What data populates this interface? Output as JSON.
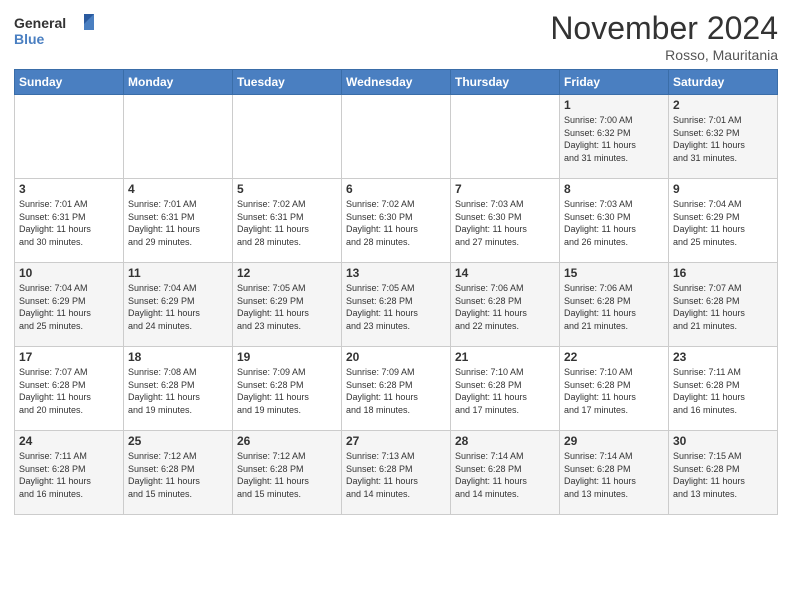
{
  "header": {
    "logo_general": "General",
    "logo_blue": "Blue",
    "month_title": "November 2024",
    "location": "Rosso, Mauritania"
  },
  "weekdays": [
    "Sunday",
    "Monday",
    "Tuesday",
    "Wednesday",
    "Thursday",
    "Friday",
    "Saturday"
  ],
  "weeks": [
    [
      {
        "day": "",
        "info": ""
      },
      {
        "day": "",
        "info": ""
      },
      {
        "day": "",
        "info": ""
      },
      {
        "day": "",
        "info": ""
      },
      {
        "day": "",
        "info": ""
      },
      {
        "day": "1",
        "info": "Sunrise: 7:00 AM\nSunset: 6:32 PM\nDaylight: 11 hours\nand 31 minutes."
      },
      {
        "day": "2",
        "info": "Sunrise: 7:01 AM\nSunset: 6:32 PM\nDaylight: 11 hours\nand 31 minutes."
      }
    ],
    [
      {
        "day": "3",
        "info": "Sunrise: 7:01 AM\nSunset: 6:31 PM\nDaylight: 11 hours\nand 30 minutes."
      },
      {
        "day": "4",
        "info": "Sunrise: 7:01 AM\nSunset: 6:31 PM\nDaylight: 11 hours\nand 29 minutes."
      },
      {
        "day": "5",
        "info": "Sunrise: 7:02 AM\nSunset: 6:31 PM\nDaylight: 11 hours\nand 28 minutes."
      },
      {
        "day": "6",
        "info": "Sunrise: 7:02 AM\nSunset: 6:30 PM\nDaylight: 11 hours\nand 28 minutes."
      },
      {
        "day": "7",
        "info": "Sunrise: 7:03 AM\nSunset: 6:30 PM\nDaylight: 11 hours\nand 27 minutes."
      },
      {
        "day": "8",
        "info": "Sunrise: 7:03 AM\nSunset: 6:30 PM\nDaylight: 11 hours\nand 26 minutes."
      },
      {
        "day": "9",
        "info": "Sunrise: 7:04 AM\nSunset: 6:29 PM\nDaylight: 11 hours\nand 25 minutes."
      }
    ],
    [
      {
        "day": "10",
        "info": "Sunrise: 7:04 AM\nSunset: 6:29 PM\nDaylight: 11 hours\nand 25 minutes."
      },
      {
        "day": "11",
        "info": "Sunrise: 7:04 AM\nSunset: 6:29 PM\nDaylight: 11 hours\nand 24 minutes."
      },
      {
        "day": "12",
        "info": "Sunrise: 7:05 AM\nSunset: 6:29 PM\nDaylight: 11 hours\nand 23 minutes."
      },
      {
        "day": "13",
        "info": "Sunrise: 7:05 AM\nSunset: 6:28 PM\nDaylight: 11 hours\nand 23 minutes."
      },
      {
        "day": "14",
        "info": "Sunrise: 7:06 AM\nSunset: 6:28 PM\nDaylight: 11 hours\nand 22 minutes."
      },
      {
        "day": "15",
        "info": "Sunrise: 7:06 AM\nSunset: 6:28 PM\nDaylight: 11 hours\nand 21 minutes."
      },
      {
        "day": "16",
        "info": "Sunrise: 7:07 AM\nSunset: 6:28 PM\nDaylight: 11 hours\nand 21 minutes."
      }
    ],
    [
      {
        "day": "17",
        "info": "Sunrise: 7:07 AM\nSunset: 6:28 PM\nDaylight: 11 hours\nand 20 minutes."
      },
      {
        "day": "18",
        "info": "Sunrise: 7:08 AM\nSunset: 6:28 PM\nDaylight: 11 hours\nand 19 minutes."
      },
      {
        "day": "19",
        "info": "Sunrise: 7:09 AM\nSunset: 6:28 PM\nDaylight: 11 hours\nand 19 minutes."
      },
      {
        "day": "20",
        "info": "Sunrise: 7:09 AM\nSunset: 6:28 PM\nDaylight: 11 hours\nand 18 minutes."
      },
      {
        "day": "21",
        "info": "Sunrise: 7:10 AM\nSunset: 6:28 PM\nDaylight: 11 hours\nand 17 minutes."
      },
      {
        "day": "22",
        "info": "Sunrise: 7:10 AM\nSunset: 6:28 PM\nDaylight: 11 hours\nand 17 minutes."
      },
      {
        "day": "23",
        "info": "Sunrise: 7:11 AM\nSunset: 6:28 PM\nDaylight: 11 hours\nand 16 minutes."
      }
    ],
    [
      {
        "day": "24",
        "info": "Sunrise: 7:11 AM\nSunset: 6:28 PM\nDaylight: 11 hours\nand 16 minutes."
      },
      {
        "day": "25",
        "info": "Sunrise: 7:12 AM\nSunset: 6:28 PM\nDaylight: 11 hours\nand 15 minutes."
      },
      {
        "day": "26",
        "info": "Sunrise: 7:12 AM\nSunset: 6:28 PM\nDaylight: 11 hours\nand 15 minutes."
      },
      {
        "day": "27",
        "info": "Sunrise: 7:13 AM\nSunset: 6:28 PM\nDaylight: 11 hours\nand 14 minutes."
      },
      {
        "day": "28",
        "info": "Sunrise: 7:14 AM\nSunset: 6:28 PM\nDaylight: 11 hours\nand 14 minutes."
      },
      {
        "day": "29",
        "info": "Sunrise: 7:14 AM\nSunset: 6:28 PM\nDaylight: 11 hours\nand 13 minutes."
      },
      {
        "day": "30",
        "info": "Sunrise: 7:15 AM\nSunset: 6:28 PM\nDaylight: 11 hours\nand 13 minutes."
      }
    ]
  ]
}
